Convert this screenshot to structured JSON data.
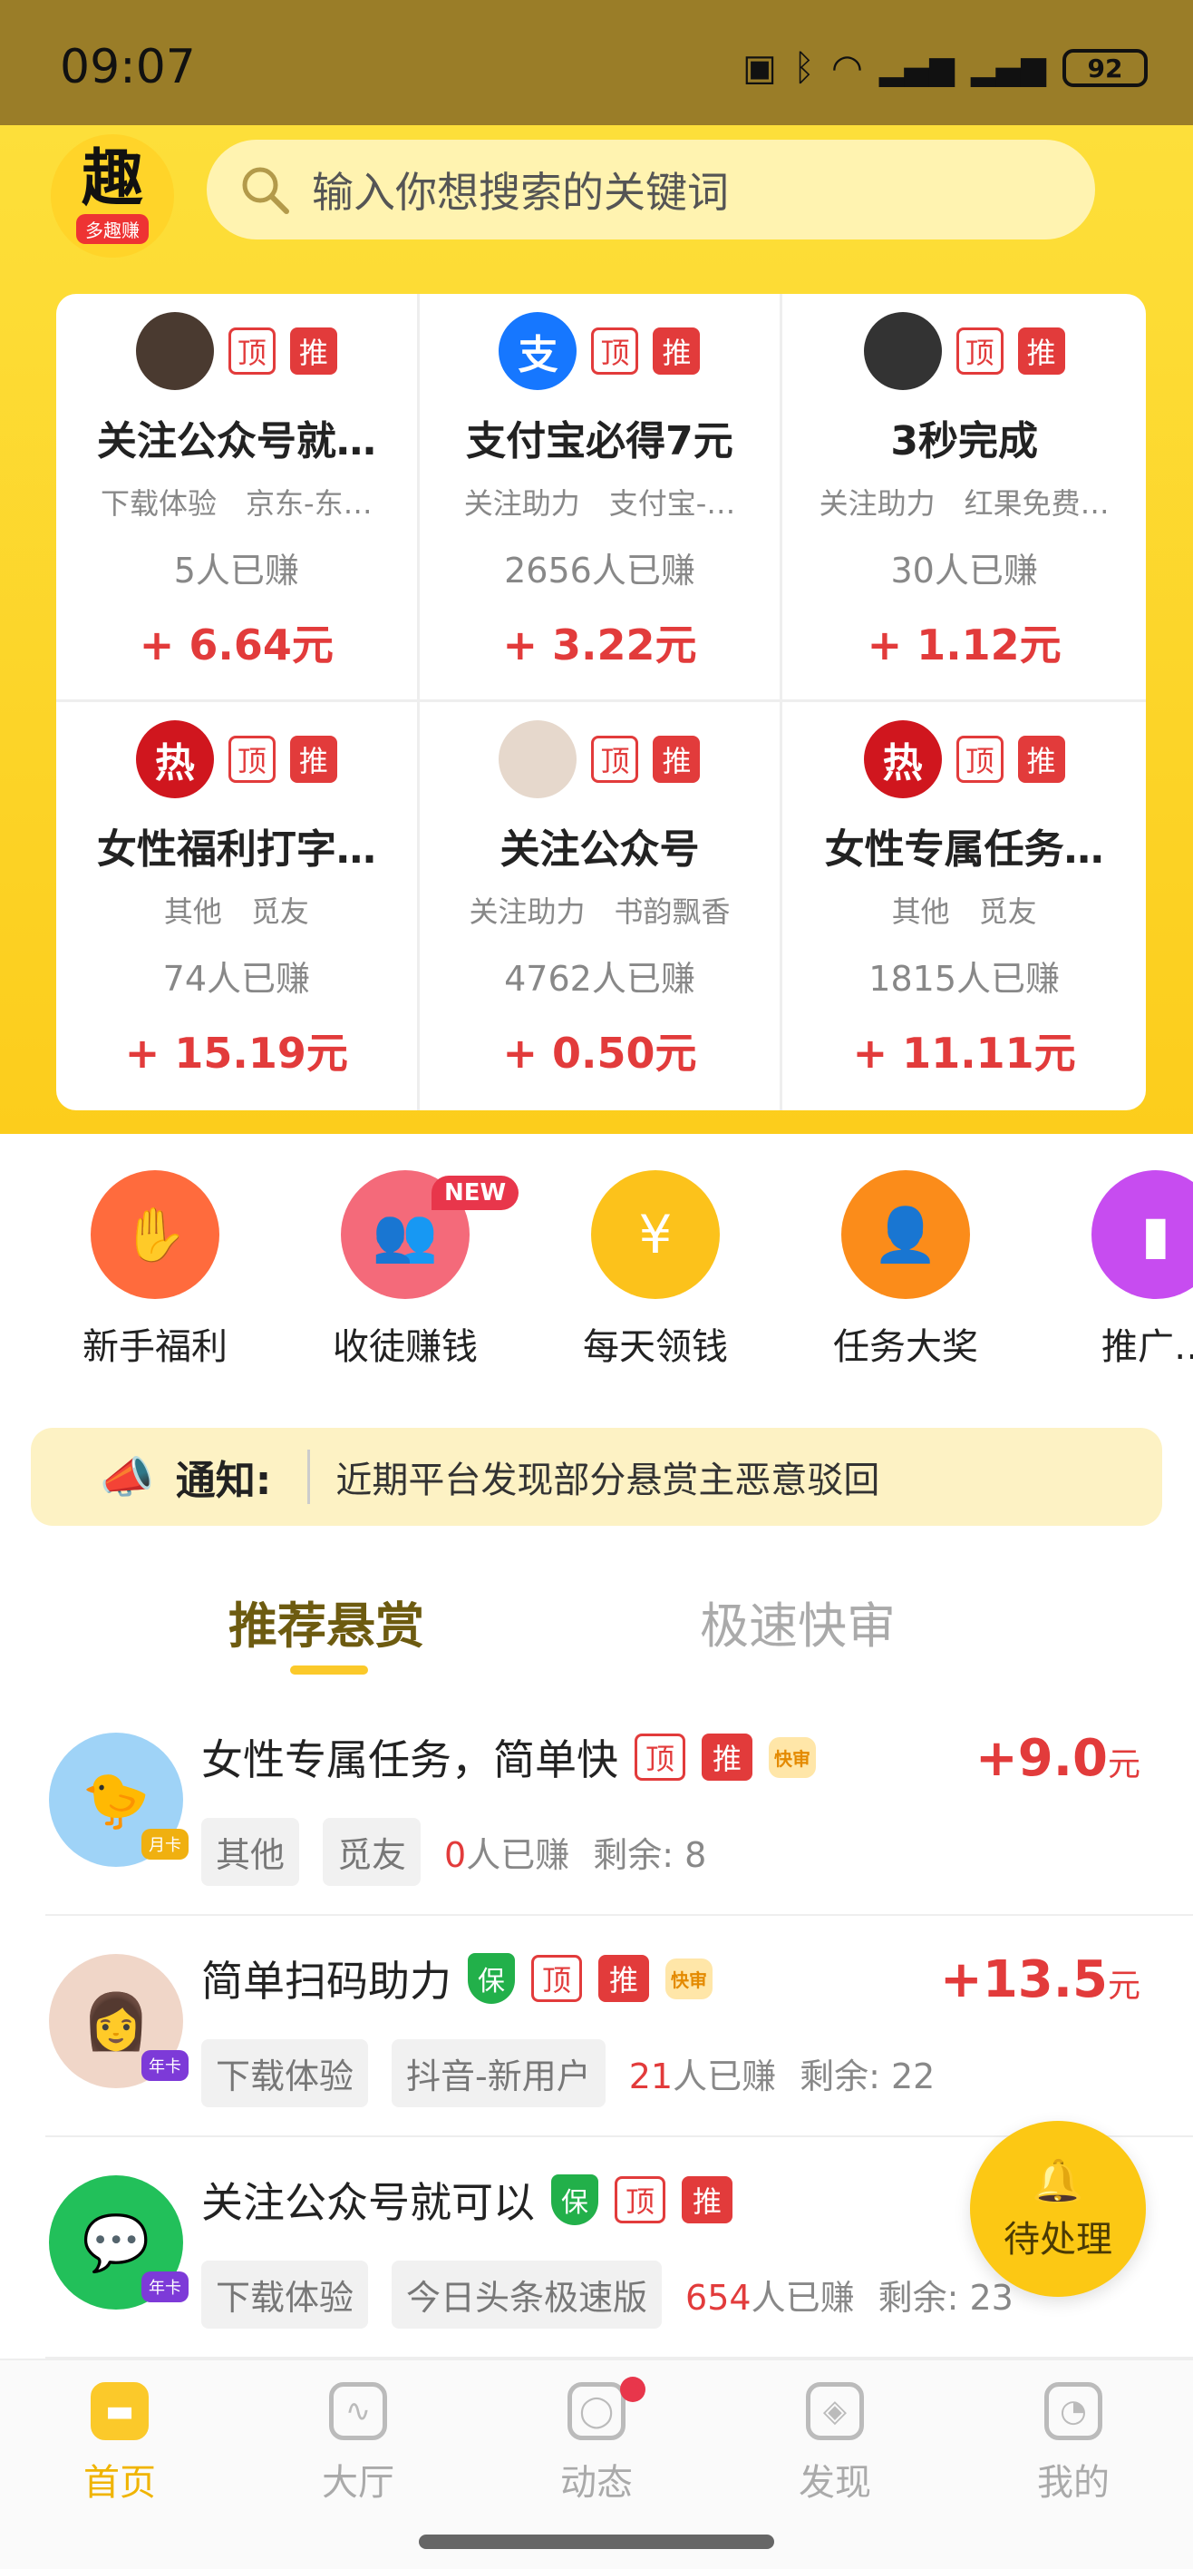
{
  "status": {
    "time": "09:07",
    "battery": "92"
  },
  "logo": {
    "text": "趣",
    "subtext": "多趣赚"
  },
  "search": {
    "placeholder": "输入你想搜索的关键词"
  },
  "tag": {
    "ding": "顶",
    "tui": "推"
  },
  "featured": [
    {
      "title": "关注公众号就…",
      "sub": "下载体验　京东-东…",
      "earned": "5人已赚",
      "reward": "+ 6.64元",
      "avatar_color": "#4a3a30",
      "avatar_text": ""
    },
    {
      "title": "支付宝必得7元",
      "sub": "关注助力　支付宝-…",
      "earned": "2656人已赚",
      "reward": "+ 3.22元",
      "avatar_color": "#1677ff",
      "avatar_text": "支"
    },
    {
      "title": "3秒完成",
      "sub": "关注助力　红果免费…",
      "earned": "30人已赚",
      "reward": "+ 1.12元",
      "avatar_color": "#333333",
      "avatar_text": ""
    },
    {
      "title": "女性福利打字…",
      "sub": "其他　觅友",
      "earned": "74人已赚",
      "reward": "+ 15.19元",
      "avatar_color": "#d0161e",
      "avatar_text": "热"
    },
    {
      "title": "关注公众号",
      "sub": "关注助力　书韵飘香",
      "earned": "4762人已赚",
      "reward": "+ 0.50元",
      "avatar_color": "#e6d8cc",
      "avatar_text": ""
    },
    {
      "title": "女性专属任务…",
      "sub": "其他　觅友",
      "earned": "1815人已赚",
      "reward": "+ 11.11元",
      "avatar_color": "#d0161e",
      "avatar_text": "热"
    }
  ],
  "shortcuts": [
    {
      "label": "新手福利",
      "color": "#ff6b3d",
      "icon": "gift-icon",
      "glyph": "✋"
    },
    {
      "label": "收徒赚钱",
      "color": "#f46a7a",
      "icon": "people-coins-icon",
      "glyph": "👥"
    },
    {
      "label": "每天领钱",
      "color": "#fcc21b",
      "icon": "money-bag-icon",
      "glyph": "¥"
    },
    {
      "label": "任务大奖",
      "color": "#fb8c1a",
      "icon": "person-reward-icon",
      "glyph": "👤"
    },
    {
      "label": "推广…",
      "color": "#c74cf0",
      "icon": "promote-icon",
      "glyph": "▮"
    }
  ],
  "shortcut_badge": "NEW",
  "notice": {
    "label": "通知:",
    "message": "近期平台发现部分悬赏主恶意驳回"
  },
  "tabs": {
    "active": "推荐悬赏",
    "inactive": "极速快审"
  },
  "quick_label": "快审",
  "shield_label": "保",
  "tasks": [
    {
      "title": "女性专属任务，简单快",
      "price": "+9.0",
      "unit": "元",
      "chips": [
        "其他",
        "觅友"
      ],
      "count": "0",
      "count_suffix": "人已赚",
      "remain": "剩余: 8",
      "avatar_color": "#9fd3f7",
      "avatar_glyph": "🐤",
      "badge": "月卡"
    },
    {
      "title": "简单扫码助力",
      "price": "+13.5",
      "unit": "元",
      "chips": [
        "下载体验",
        "抖音-新用户"
      ],
      "count": "21",
      "count_suffix": "人已赚",
      "remain": "剩余: 22",
      "avatar_color": "#f0d6c8",
      "avatar_glyph": "👩",
      "badge": "年卡"
    },
    {
      "title": "关注公众号就可以",
      "price": "+",
      "unit": "",
      "chips": [
        "下载体验",
        "今日头条极速版"
      ],
      "count": "654",
      "count_suffix": "人已赚",
      "remain": "剩余: 23",
      "avatar_color": "#22c05a",
      "avatar_glyph": "💬",
      "badge": "年卡"
    }
  ],
  "pending": {
    "label": "待处理"
  },
  "tabbar": [
    {
      "label": "首页",
      "icon": "home-icon",
      "active": true
    },
    {
      "label": "大厅",
      "icon": "chart-icon",
      "active": false
    },
    {
      "label": "动态",
      "icon": "planet-icon",
      "active": false
    },
    {
      "label": "发现",
      "icon": "compass-icon",
      "active": false
    },
    {
      "label": "我的",
      "icon": "profile-icon",
      "active": false
    }
  ]
}
